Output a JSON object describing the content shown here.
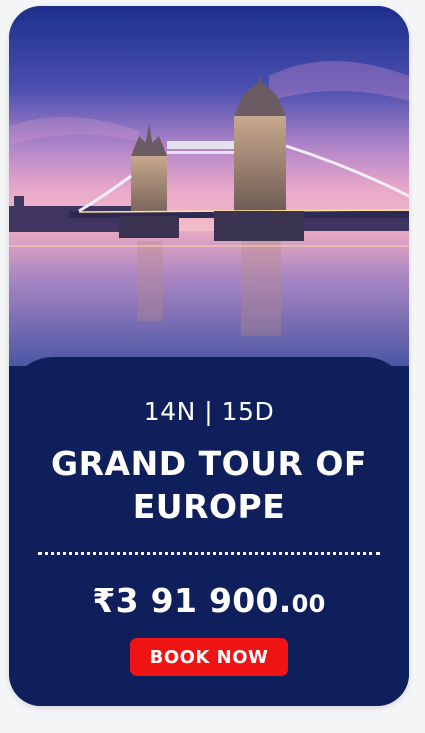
{
  "card": {
    "duration": "14N | 15D",
    "title": "GRAND TOUR OF EUROPE",
    "price_main": "₹3 91 900.",
    "price_cents": "00",
    "cta_label": "BOOK NOW"
  },
  "colors": {
    "card_bg": "#0f1f5b",
    "button_bg": "#f01313",
    "text": "#ffffff"
  }
}
